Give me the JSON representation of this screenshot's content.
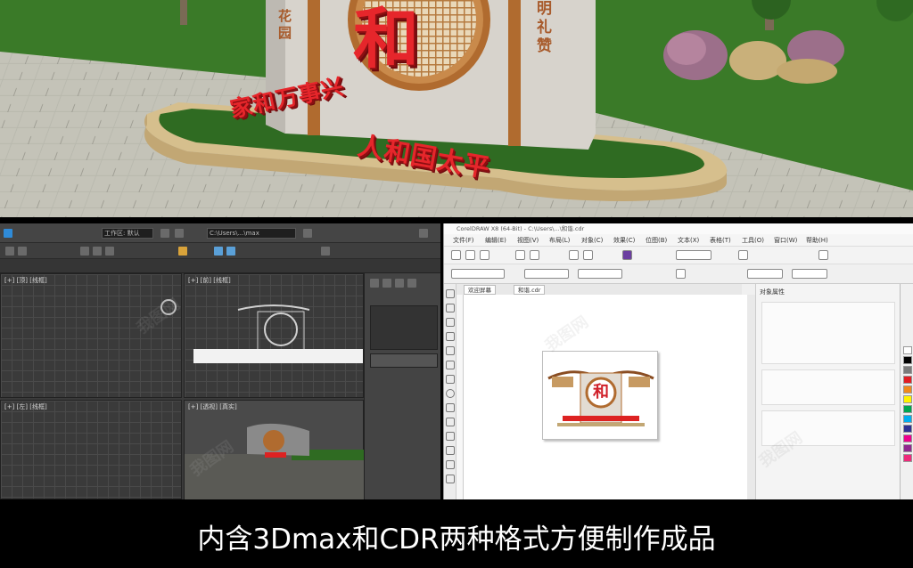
{
  "scene": {
    "slogan_left": "家和万事兴",
    "slogan_right": "人和国太平",
    "center_char": "和",
    "side_left_text": "花园",
    "side_right_text": "明礼赞"
  },
  "max_app": {
    "menu_field_1": "工作区: 默认",
    "menu_field_2": "C:\\Users\\...\\max",
    "viewport_top_label": "[+] [顶] [线框]",
    "viewport_persp_label": "[+] [透视] [真实]",
    "viewport_left_label": "[+] [左] [线框]",
    "viewport_front_label": "[+] [前] [线框]"
  },
  "cdr_app": {
    "title": "CorelDRAW X8 (64-Bit) - C:\\Users\\...\\和谐.cdr",
    "menu": [
      "文件(F)",
      "编辑(E)",
      "视图(V)",
      "布局(L)",
      "对象(C)",
      "效果(C)",
      "位图(B)",
      "文本(X)",
      "表格(T)",
      "工具(O)",
      "窗口(W)",
      "帮助(H)"
    ],
    "tab_welcome": "欢迎屏幕",
    "tab_doc": "和谐.cdr",
    "docker_title": "对象属性",
    "page_char": "和"
  },
  "watermark": "我图网",
  "caption": "内含3Dmax和CDR两种格式方便制作成品",
  "colors": {
    "accent_red": "#e6262b",
    "wood_brown": "#a85b2c",
    "grass": "#3d7a2a"
  }
}
